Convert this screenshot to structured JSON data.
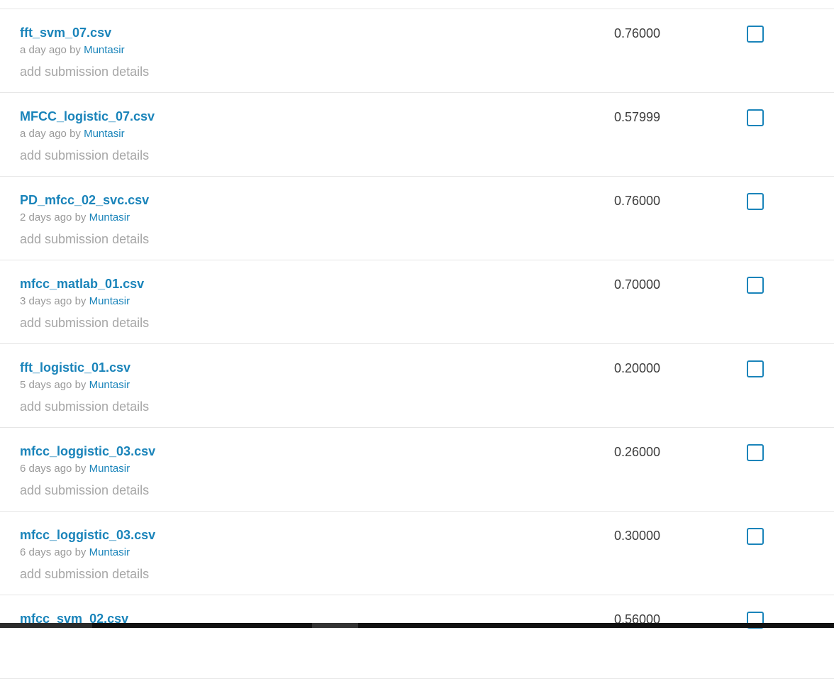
{
  "submissions": [
    {
      "file": "fft_svm_07.csv",
      "time": "a day ago",
      "by": "by",
      "author": "Muntasir",
      "details": "add submission details",
      "score": "0.76000"
    },
    {
      "file": "MFCC_logistic_07.csv",
      "time": "a day ago",
      "by": "by",
      "author": "Muntasir",
      "details": "add submission details",
      "score": "0.57999"
    },
    {
      "file": "PD_mfcc_02_svc.csv",
      "time": "2 days ago",
      "by": "by",
      "author": "Muntasir",
      "details": "add submission details",
      "score": "0.76000"
    },
    {
      "file": "mfcc_matlab_01.csv",
      "time": "3 days ago",
      "by": "by",
      "author": "Muntasir",
      "details": "add submission details",
      "score": "0.70000"
    },
    {
      "file": "fft_logistic_01.csv",
      "time": "5 days ago",
      "by": "by",
      "author": "Muntasir",
      "details": "add submission details",
      "score": "0.20000"
    },
    {
      "file": "mfcc_loggistic_03.csv",
      "time": "6 days ago",
      "by": "by",
      "author": "Muntasir",
      "details": "add submission details",
      "score": "0.26000"
    },
    {
      "file": "mfcc_loggistic_03.csv",
      "time": "6 days ago",
      "by": "by",
      "author": "Muntasir",
      "details": "add submission details",
      "score": "0.30000"
    },
    {
      "file": "mfcc_svm_02.csv",
      "time": "",
      "by": "",
      "author": "",
      "details": "",
      "score": "0.56000"
    }
  ],
  "colors": {
    "link": "#1a84ba",
    "muted": "#999999",
    "score": "#3c3c3c",
    "divider": "#e6e6e6"
  }
}
